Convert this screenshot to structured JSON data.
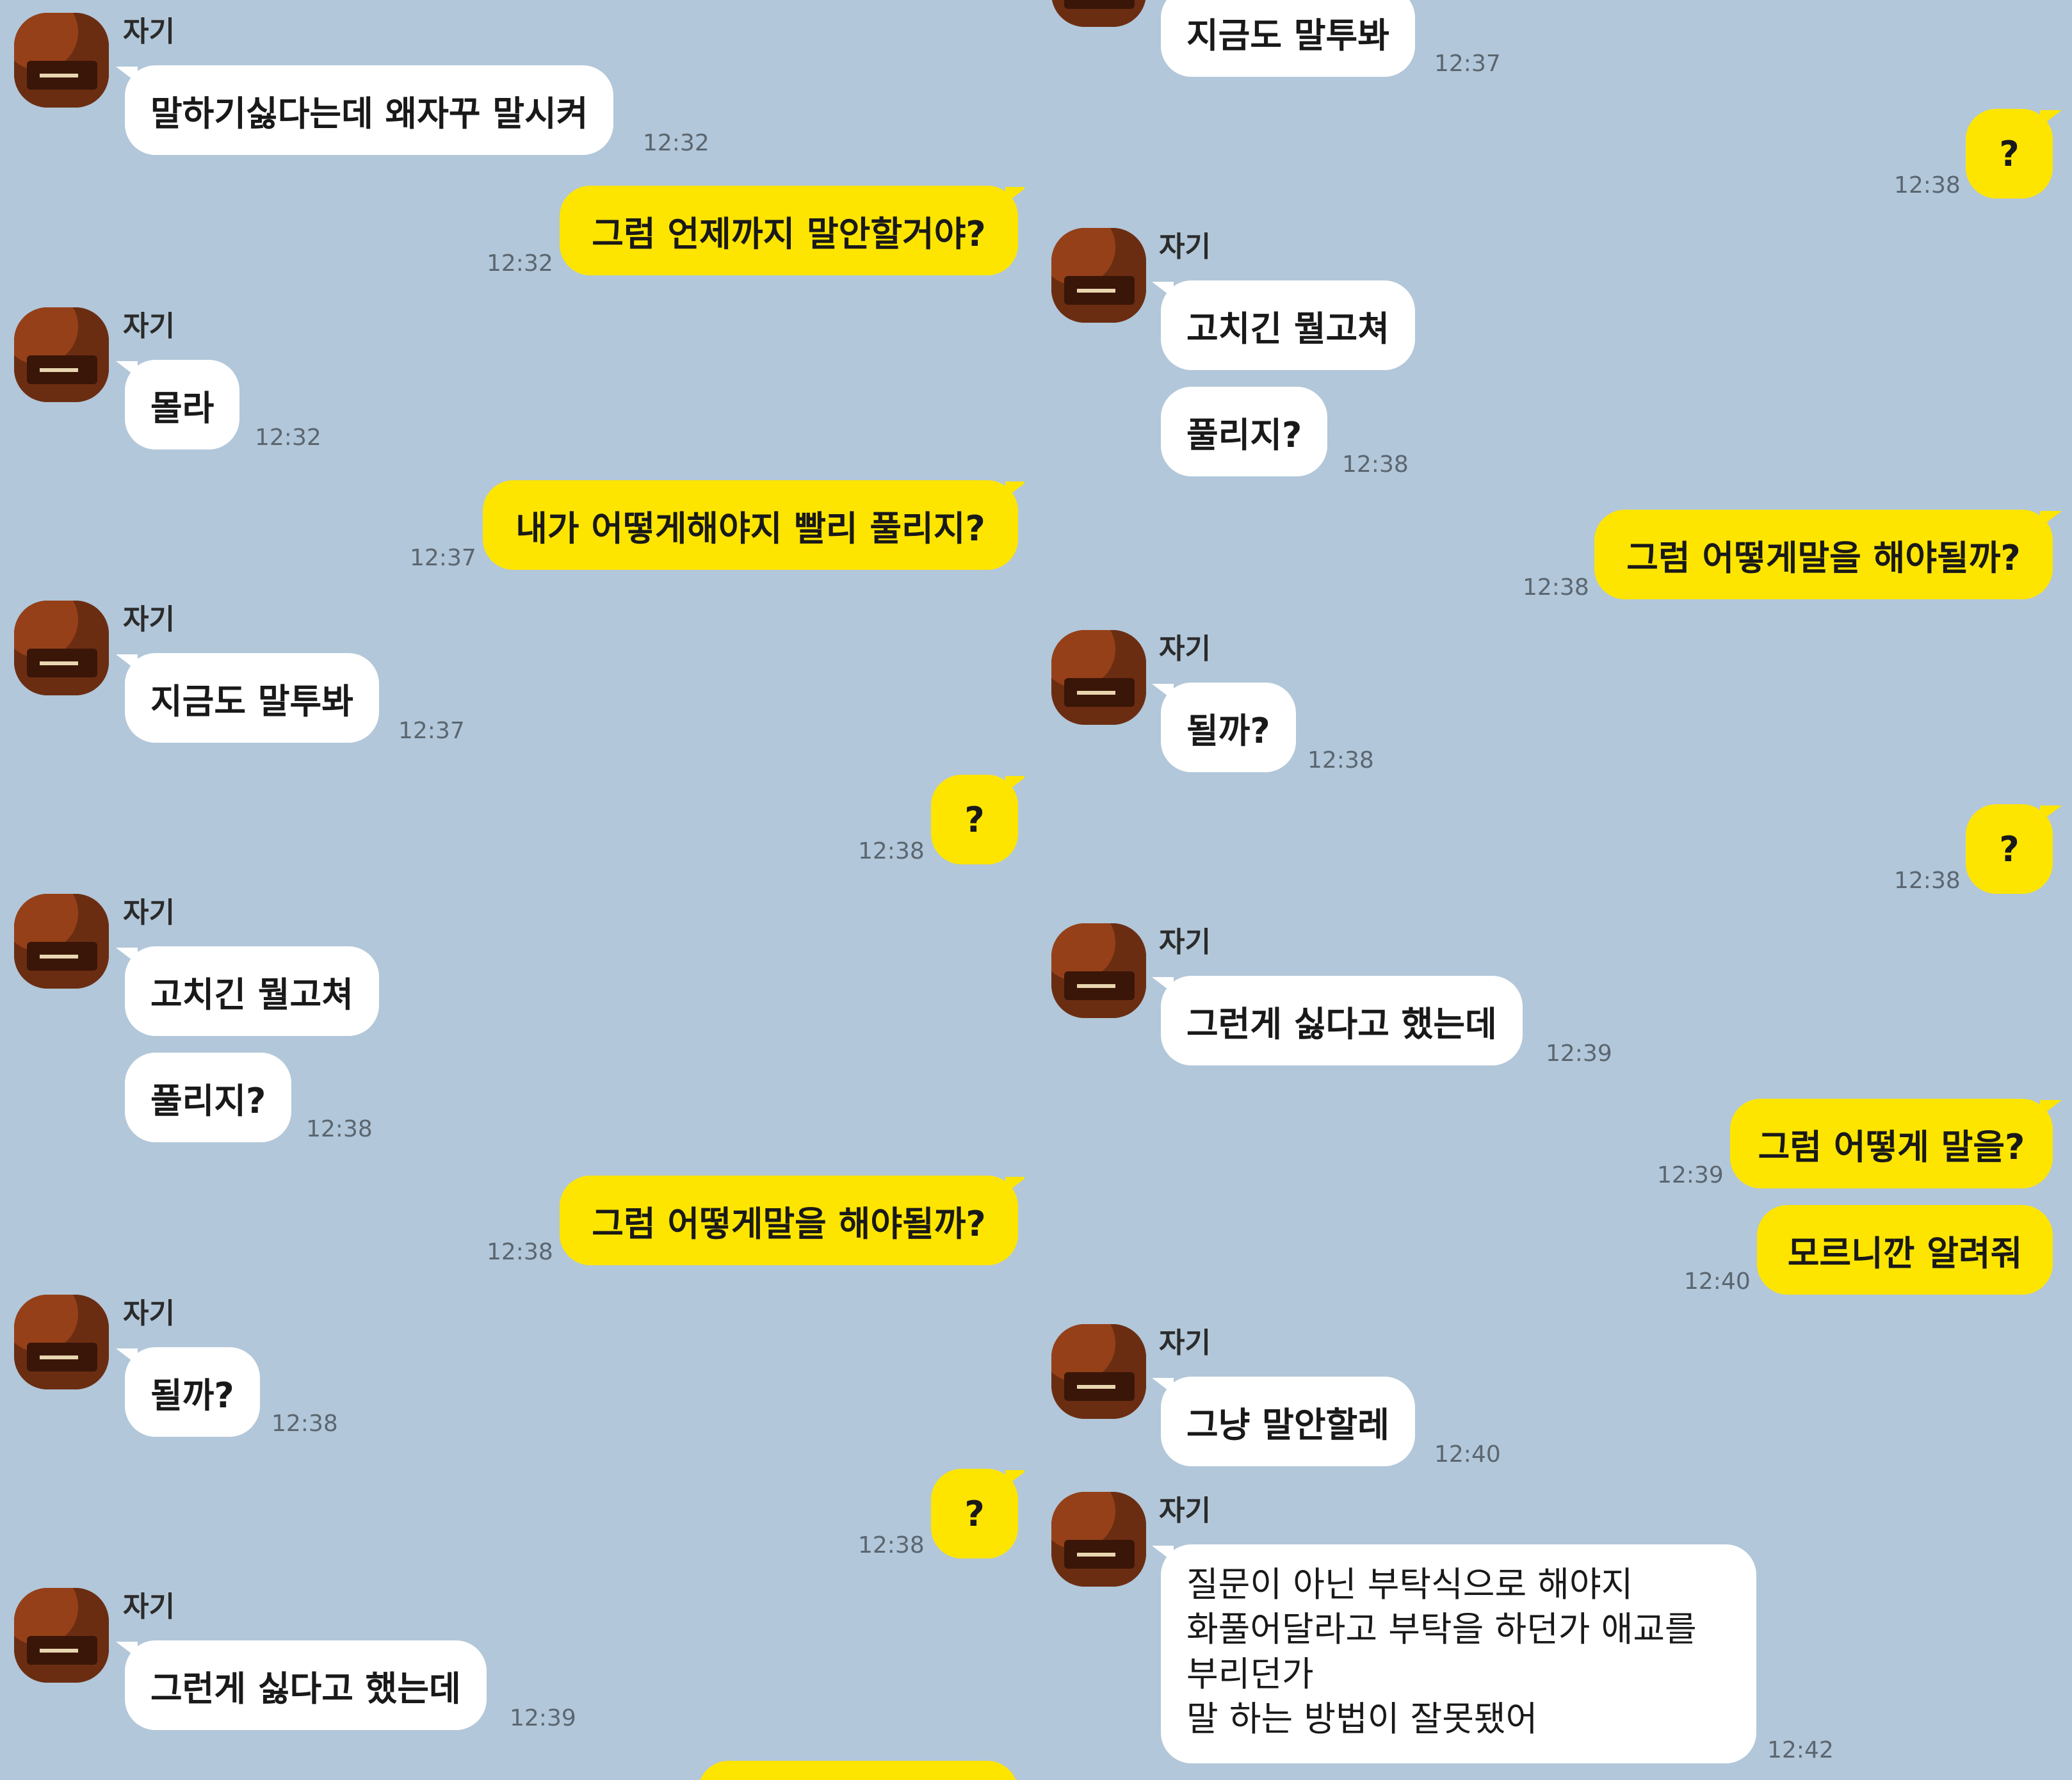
{
  "contact": {
    "name": "자기"
  },
  "left_column": {
    "messages": [
      {
        "text": "말하기싫다는데 왜자꾸 말시켜",
        "time": "12:32"
      },
      {
        "text": "그럼 언제까지 말안할거야?",
        "time": "12:32"
      },
      {
        "text": "몰라",
        "time": "12:32"
      },
      {
        "text": "내가 어떻게해야지 빨리 풀리지?",
        "time": "12:37"
      },
      {
        "text": "지금도 말투봐",
        "time": "12:37"
      },
      {
        "text": "?",
        "time": "12:38"
      },
      {
        "text": "고치긴 뭘고쳐"
      },
      {
        "text": "풀리지?",
        "time": "12:38"
      },
      {
        "text": "그럼 어떻게말을 해야될까?",
        "time": "12:38"
      },
      {
        "text": "될까?",
        "time": "12:38"
      },
      {
        "text": "?",
        "time": "12:38"
      },
      {
        "text": "그런게 싫다고 했는데",
        "time": "12:39"
      }
    ]
  },
  "right_column": {
    "messages": [
      {
        "text": "지금도 말투봐",
        "time": "12:37"
      },
      {
        "text": "?",
        "time": "12:38"
      },
      {
        "text": "고치긴 뭘고쳐"
      },
      {
        "text": "풀리지?",
        "time": "12:38"
      },
      {
        "text": "그럼 어떻게말을 해야될까?",
        "time": "12:38"
      },
      {
        "text": "될까?",
        "time": "12:38"
      },
      {
        "text": "?",
        "time": "12:38"
      },
      {
        "text": "그런게 싫다고 했는데",
        "time": "12:39"
      },
      {
        "text": "그럼 어떻게 말을?",
        "time": "12:39"
      },
      {
        "text": "모르니깐 알려줘",
        "time": "12:40"
      },
      {
        "text": "그냥 말안할레",
        "time": "12:40"
      },
      {
        "lines": [
          "질문이 아닌 부탁식으로 해야지",
          "화풀어달라고 부탁을 하던가 애교를",
          "부리던가",
          "말 하는 방법이 잘못됐어"
        ],
        "time": "12:42"
      }
    ]
  },
  "colors": {
    "background": "#B2C7D9",
    "outgoing_bubble": "#FEE500",
    "incoming_bubble": "#FFFFFF"
  },
  "icons": {
    "avatar": "profile-photo"
  }
}
